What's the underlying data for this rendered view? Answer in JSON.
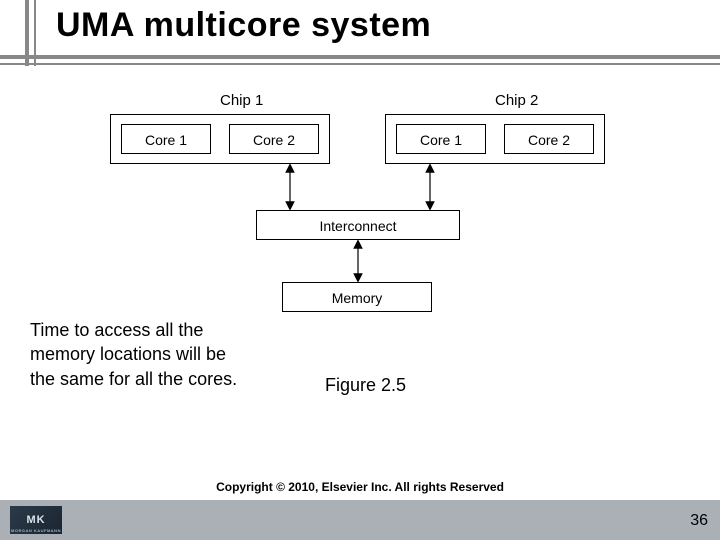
{
  "title": "UMA multicore system",
  "diagram": {
    "chip1_label": "Chip 1",
    "chip2_label": "Chip 2",
    "chip1_cores": [
      "Core 1",
      "Core 2"
    ],
    "chip2_cores": [
      "Core 1",
      "Core 2"
    ],
    "interconnect": "Interconnect",
    "memory": "Memory"
  },
  "note_text": "Time to access all the memory locations will be the same for all the cores.",
  "figure_label": "Figure 2.5",
  "logo_text": "MK",
  "logo_sub": "MORGAN KAUFMANN",
  "copyright": "Copyright © 2010, Elsevier Inc. All rights Reserved",
  "page_number": "36",
  "chart_data": {
    "type": "diagram",
    "title": "UMA multicore system",
    "nodes": [
      {
        "id": "chip1",
        "label": "Chip 1",
        "children": [
          "core1a",
          "core1b"
        ]
      },
      {
        "id": "core1a",
        "label": "Core 1"
      },
      {
        "id": "core1b",
        "label": "Core 2"
      },
      {
        "id": "chip2",
        "label": "Chip 2",
        "children": [
          "core2a",
          "core2b"
        ]
      },
      {
        "id": "core2a",
        "label": "Core 1"
      },
      {
        "id": "core2b",
        "label": "Core 2"
      },
      {
        "id": "interconnect",
        "label": "Interconnect"
      },
      {
        "id": "memory",
        "label": "Memory"
      }
    ],
    "edges": [
      {
        "from": "chip1",
        "to": "interconnect",
        "bidirectional": true
      },
      {
        "from": "chip2",
        "to": "interconnect",
        "bidirectional": true
      },
      {
        "from": "interconnect",
        "to": "memory",
        "bidirectional": true
      }
    ],
    "caption": "Figure 2.5",
    "annotation": "Time to access all the memory locations will be the same for all the cores."
  }
}
